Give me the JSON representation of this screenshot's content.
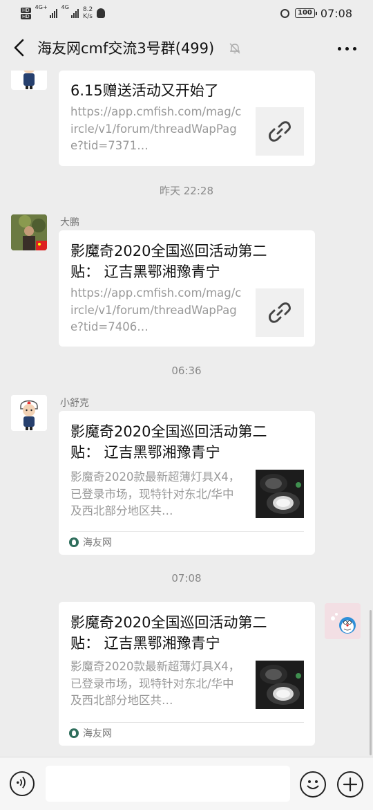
{
  "status_bar": {
    "hd1": "HD",
    "hd2": "HD",
    "net": "4G+",
    "net2": "4G",
    "speed_value": "8.2",
    "speed_unit": "K/s",
    "battery": "100",
    "time": "07:08"
  },
  "header": {
    "title": "海友网cmf交流3号群(499)"
  },
  "messages": [
    {
      "title": "6.15赠送活动又开始了",
      "desc": "https://app.cmfish.com/mag/circle/v1/forum/threadWapPage?tid=7371…"
    },
    {
      "timestamp": "昨天 22:28",
      "sender": "大鹏",
      "title": "影魔奇2020全国巡回活动第二贴： 辽吉黑鄂湘豫青宁",
      "desc": "https://app.cmfish.com/mag/circle/v1/forum/threadWapPage?tid=7406…"
    },
    {
      "timestamp": "06:36",
      "sender": "小舒克",
      "title": "影魔奇2020全国巡回活动第二贴： 辽吉黑鄂湘豫青宁",
      "desc": "影魔奇2020款最新超薄灯具X4，已登录市场，现特针对东北/华中及西北部分地区共…",
      "source": "海友网"
    },
    {
      "timestamp": "07:08",
      "title": "影魔奇2020全国巡回活动第二贴： 辽吉黑鄂湘豫青宁",
      "desc": "影魔奇2020款最新超薄灯具X4，已登录市场，现特针对东北/华中及西北部分地区共…",
      "source": "海友网"
    }
  ],
  "colors": {
    "background": "#ededed",
    "card": "#ffffff",
    "muted_text": "#999999"
  }
}
